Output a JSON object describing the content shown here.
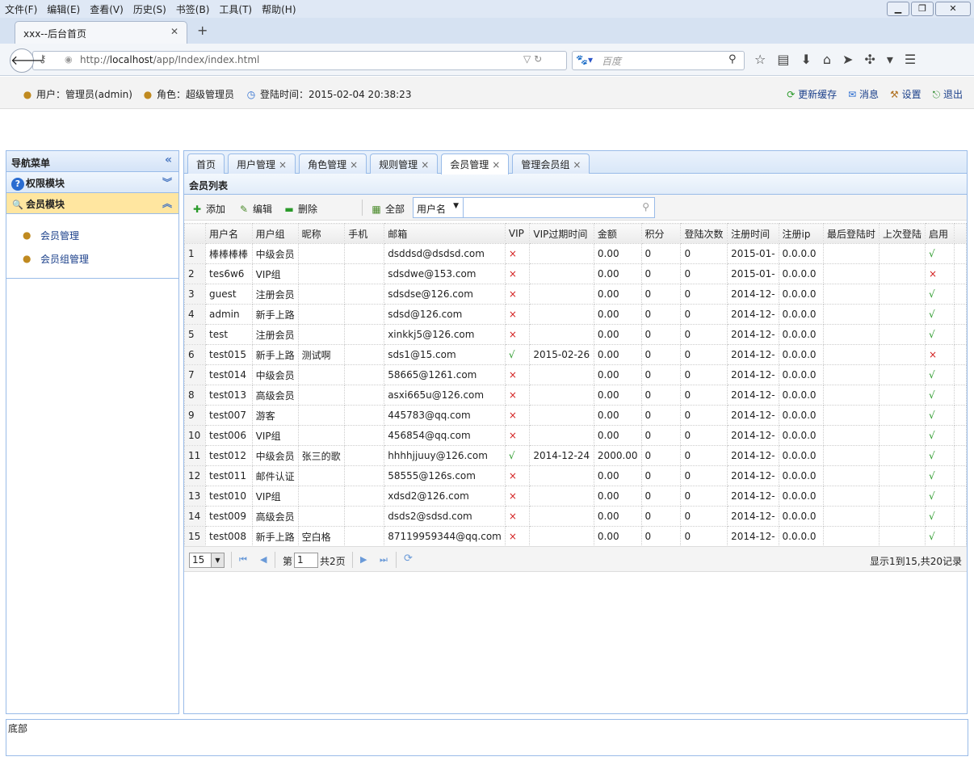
{
  "browser": {
    "menu": [
      "文件(F)",
      "编辑(E)",
      "查看(V)",
      "历史(S)",
      "书签(B)",
      "工具(T)",
      "帮助(H)"
    ],
    "tab_title": "xxx--后台首页",
    "url_prefix": "http://",
    "url_host": "localhost",
    "url_path": "/app/Index/index.html",
    "search_placeholder": "百度"
  },
  "header": {
    "user": "用户：管理员(admin)",
    "role": "角色：超级管理员",
    "login_time": "登陆时间：2015-02-04 20:38:23",
    "actions": [
      "更新缓存",
      "消息",
      "设置",
      "退出"
    ]
  },
  "sidebar": {
    "title": "导航菜单",
    "modules": [
      {
        "label": "权限模块",
        "expanded": false
      },
      {
        "label": "会员模块",
        "expanded": true
      }
    ],
    "items": [
      "会员管理",
      "会员组管理"
    ]
  },
  "tabs": [
    {
      "label": "首页",
      "closable": false
    },
    {
      "label": "用户管理",
      "closable": true
    },
    {
      "label": "角色管理",
      "closable": true
    },
    {
      "label": "规则管理",
      "closable": true
    },
    {
      "label": "会员管理",
      "closable": true,
      "active": true
    },
    {
      "label": "管理会员组",
      "closable": true
    }
  ],
  "panel_title": "会员列表",
  "toolbar": {
    "add": "添加",
    "edit": "编辑",
    "delete": "删除",
    "all": "全部",
    "search_field": "用户名"
  },
  "columns": [
    "用户名",
    "用户组",
    "昵称",
    "手机",
    "邮箱",
    "VIP",
    "VIP过期时间",
    "金额",
    "积分",
    "登陆次数",
    "注册时间",
    "注册ip",
    "最后登陆时",
    "上次登陆",
    "启用"
  ],
  "rows": [
    [
      "1",
      "棒棒棒棒",
      "中级会员",
      "",
      "",
      "dsddsd@dsdsd.com",
      "×",
      "",
      "0.00",
      "0",
      "0",
      "2015-01-",
      "0.0.0.0",
      "",
      "",
      "√"
    ],
    [
      "2",
      "tes6w6",
      "VIP组",
      "",
      "",
      "sdsdwe@153.com",
      "×",
      "",
      "0.00",
      "0",
      "0",
      "2015-01-",
      "0.0.0.0",
      "",
      "",
      "×"
    ],
    [
      "3",
      "guest",
      "注册会员",
      "",
      "",
      "sdsdse@126.com",
      "×",
      "",
      "0.00",
      "0",
      "0",
      "2014-12-",
      "0.0.0.0",
      "",
      "",
      "√"
    ],
    [
      "4",
      "admin",
      "新手上路",
      "",
      "",
      "sdsd@126.com",
      "×",
      "",
      "0.00",
      "0",
      "0",
      "2014-12-",
      "0.0.0.0",
      "",
      "",
      "√"
    ],
    [
      "5",
      "test",
      "注册会员",
      "",
      "",
      "xinkkj5@126.com",
      "×",
      "",
      "0.00",
      "0",
      "0",
      "2014-12-",
      "0.0.0.0",
      "",
      "",
      "√"
    ],
    [
      "6",
      "test015",
      "新手上路",
      "测试啊",
      "",
      "sds1@15.com",
      "√",
      "2015-02-26",
      "0.00",
      "0",
      "0",
      "2014-12-",
      "0.0.0.0",
      "",
      "",
      "×"
    ],
    [
      "7",
      "test014",
      "中级会员",
      "",
      "",
      "58665@1261.com",
      "×",
      "",
      "0.00",
      "0",
      "0",
      "2014-12-",
      "0.0.0.0",
      "",
      "",
      "√"
    ],
    [
      "8",
      "test013",
      "高级会员",
      "",
      "",
      "asxi665u@126.com",
      "×",
      "",
      "0.00",
      "0",
      "0",
      "2014-12-",
      "0.0.0.0",
      "",
      "",
      "√"
    ],
    [
      "9",
      "test007",
      "游客",
      "",
      "",
      "445783@qq.com",
      "×",
      "",
      "0.00",
      "0",
      "0",
      "2014-12-",
      "0.0.0.0",
      "",
      "",
      "√"
    ],
    [
      "10",
      "test006",
      "VIP组",
      "",
      "",
      "456854@qq.com",
      "×",
      "",
      "0.00",
      "0",
      "0",
      "2014-12-",
      "0.0.0.0",
      "",
      "",
      "√"
    ],
    [
      "11",
      "test012",
      "中级会员",
      "张三的歌",
      "",
      "hhhhjjuuy@126.com",
      "√",
      "2014-12-24",
      "2000.00",
      "0",
      "0",
      "2014-12-",
      "0.0.0.0",
      "",
      "",
      "√"
    ],
    [
      "12",
      "test011",
      "邮件认证",
      "",
      "",
      "58555@126s.com",
      "×",
      "",
      "0.00",
      "0",
      "0",
      "2014-12-",
      "0.0.0.0",
      "",
      "",
      "√"
    ],
    [
      "13",
      "test010",
      "VIP组",
      "",
      "",
      "xdsd2@126.com",
      "×",
      "",
      "0.00",
      "0",
      "0",
      "2014-12-",
      "0.0.0.0",
      "",
      "",
      "√"
    ],
    [
      "14",
      "test009",
      "高级会员",
      "",
      "",
      "dsds2@sdsd.com",
      "×",
      "",
      "0.00",
      "0",
      "0",
      "2014-12-",
      "0.0.0.0",
      "",
      "",
      "√"
    ],
    [
      "15",
      "test008",
      "新手上路",
      "空白格",
      "",
      "87119959344@qq.com",
      "×",
      "",
      "0.00",
      "0",
      "0",
      "2014-12-",
      "0.0.0.0",
      "",
      "",
      "√"
    ]
  ],
  "pager": {
    "page_size": "15",
    "page_prefix": "第",
    "page": "1",
    "page_total": "共2页",
    "summary": "显示1到15,共20记录"
  },
  "footer": "底部",
  "colors": {
    "accent": "#99bbe8",
    "yes": "#2a9a2a",
    "no": "#d32020",
    "selected_module": "#ffe6a0"
  }
}
